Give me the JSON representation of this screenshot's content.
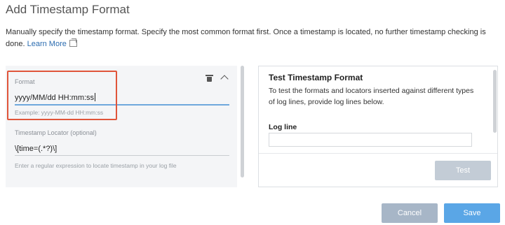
{
  "dialog": {
    "title": "Add Timestamp Format",
    "description": "Manually specify the timestamp format. Specify the most common format first. Once a timestamp is located, no further timestamp checking is done.",
    "learn_more": "Learn More",
    "icons": {
      "external_link": "external-link-icon",
      "delete": "trash-icon",
      "collapse": "chevron-up-icon"
    }
  },
  "format_entry": {
    "format_label": "Format",
    "format_value": "yyyy/MM/dd HH:mm:ss",
    "format_example": "Example: yyyy-MM-dd HH:mm:ss",
    "locator_label": "Timestamp Locator (optional)",
    "locator_value": "\\[time=(.*?)\\]",
    "locator_hint": "Enter a regular expression to locate timestamp in your log file",
    "highlight_color": "#e0553a"
  },
  "test_panel": {
    "title": "Test Timestamp Format",
    "description": "To test the formats and locators inserted against different types of log lines, provide log lines below.",
    "log_line_label": "Log line",
    "log_line_value": "",
    "test_button": "Test"
  },
  "footer": {
    "cancel_button": "Cancel",
    "save_button": "Save",
    "primary_color": "#5aa6e6"
  }
}
